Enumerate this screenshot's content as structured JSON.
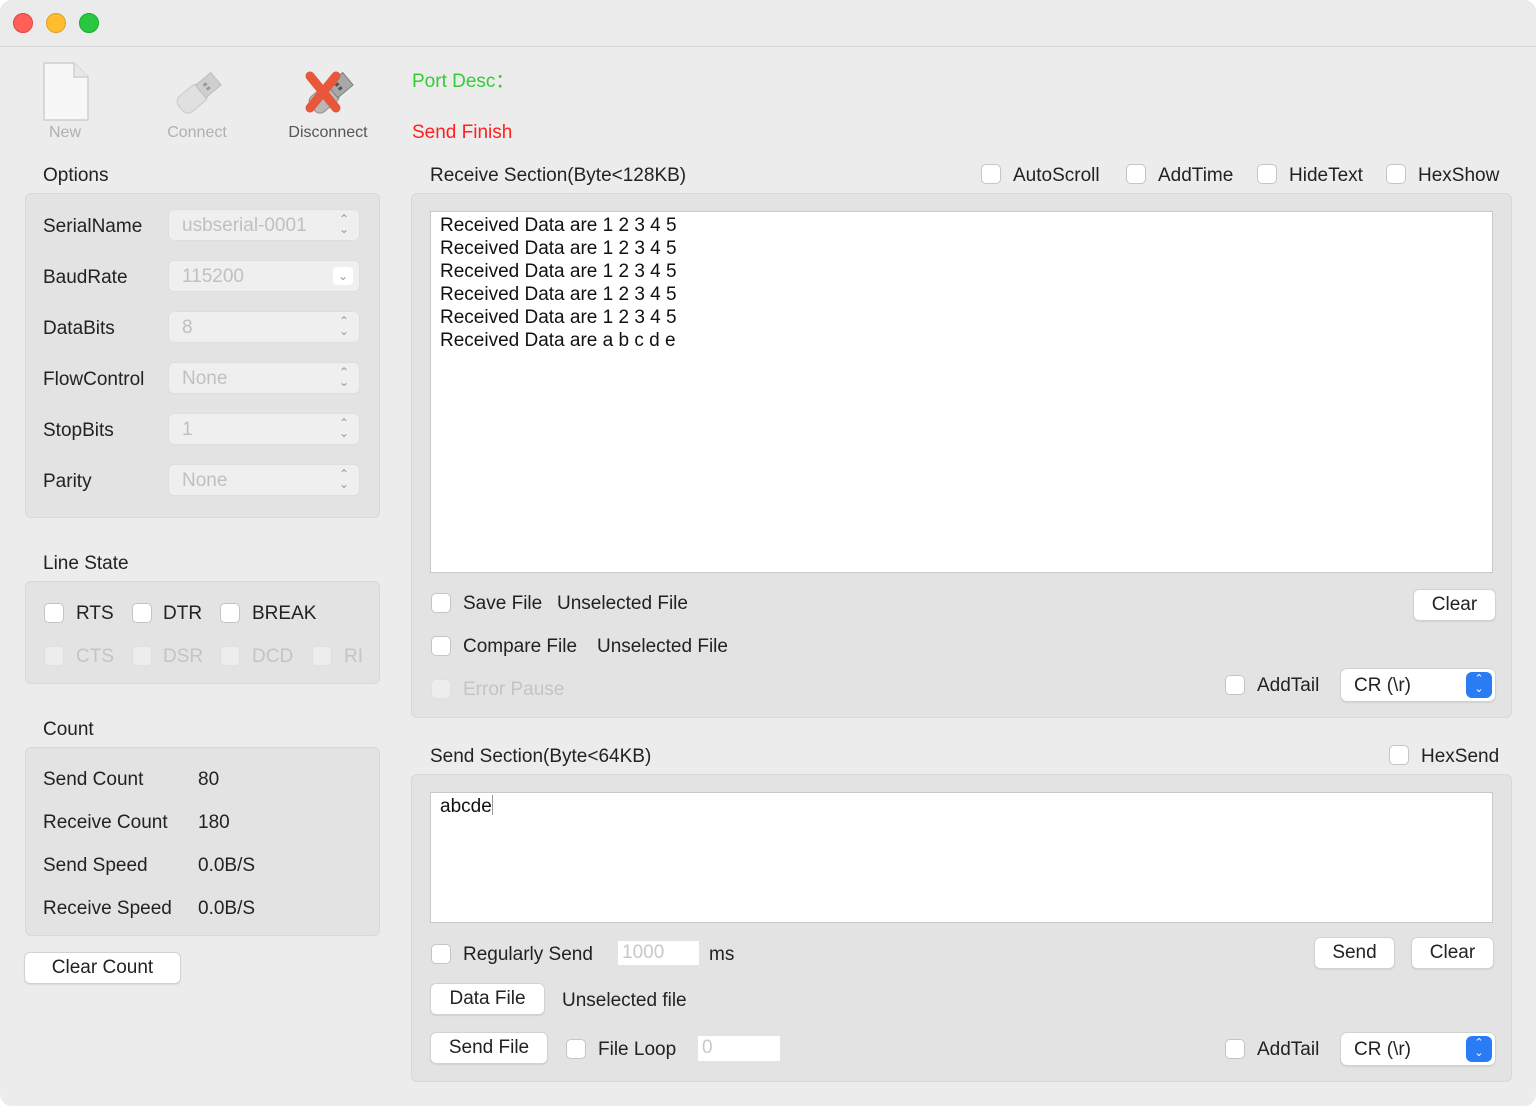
{
  "window": {
    "colors": {
      "close": "#fe5f57",
      "minimize": "#febc2e",
      "zoom": "#28c840",
      "status_green": "#33cc33",
      "status_red": "#ff1f1f",
      "accent": "#2a7cf5"
    }
  },
  "toolbar": {
    "new_label": "New",
    "connect_label": "Connect",
    "disconnect_label": "Disconnect"
  },
  "status": {
    "port_desc": "Port Desc：",
    "message": "Send Finish"
  },
  "options": {
    "title": "Options",
    "fields": [
      {
        "label": "SerialName",
        "value": "usbserial-0001"
      },
      {
        "label": "BaudRate",
        "value": "115200"
      },
      {
        "label": "DataBits",
        "value": "8"
      },
      {
        "label": "FlowControl",
        "value": "None"
      },
      {
        "label": "StopBits",
        "value": "1"
      },
      {
        "label": "Parity",
        "value": "None"
      }
    ]
  },
  "line_state": {
    "title": "Line State",
    "rts": "RTS",
    "dtr": "DTR",
    "break": "BREAK",
    "cts": "CTS",
    "dsr": "DSR",
    "dcd": "DCD",
    "ri": "RI"
  },
  "count": {
    "title": "Count",
    "rows": [
      {
        "label": "Send Count",
        "value": "80"
      },
      {
        "label": "Receive Count",
        "value": "180"
      },
      {
        "label": "Send Speed",
        "value": "0.0B/S"
      },
      {
        "label": "Receive Speed",
        "value": "0.0B/S"
      }
    ],
    "clear_label": "Clear Count"
  },
  "receive": {
    "title": "Receive Section(Byte<128KB)",
    "autoscroll": "AutoScroll",
    "addtime": "AddTime",
    "hidetext": "HideText",
    "hexshow": "HexShow",
    "lines": [
      "Received Data are 1 2 3 4 5",
      "Received Data are 1 2 3 4 5",
      "Received Data are 1 2 3 4 5",
      "Received Data are 1 2 3 4 5",
      "Received Data are 1 2 3 4 5",
      "Received Data are a b c d e"
    ],
    "save_file": "Save File",
    "save_file_status": "Unselected File",
    "compare_file": "Compare File",
    "compare_file_status": "Unselected File",
    "error_pause": "Error Pause",
    "clear_label": "Clear",
    "addtail": "AddTail",
    "tail_value": "CR (\\r)"
  },
  "send": {
    "title": "Send Section(Byte<64KB)",
    "hexsend": "HexSend",
    "text": "abcde",
    "regularly_send": "Regularly Send",
    "interval_placeholder": "1000",
    "interval_unit": "ms",
    "send_label": "Send",
    "clear_label": "Clear",
    "data_file_label": "Data File",
    "data_file_status": "Unselected file",
    "send_file_label": "Send File",
    "file_loop": "File Loop",
    "loop_placeholder": "0",
    "addtail": "AddTail",
    "tail_value": "CR (\\r)"
  }
}
